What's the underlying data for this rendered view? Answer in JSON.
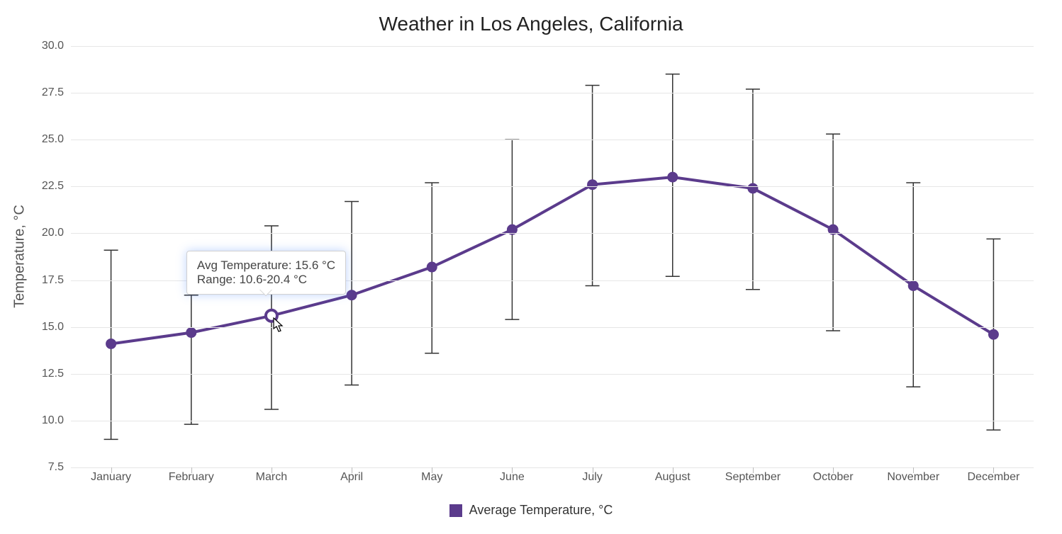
{
  "chart_data": {
    "type": "line",
    "title": "Weather in Los Angeles, California",
    "ylabel": "Temperature, °C",
    "xlabel": "",
    "categories": [
      "January",
      "February",
      "March",
      "April",
      "May",
      "June",
      "July",
      "August",
      "September",
      "October",
      "November",
      "December"
    ],
    "series": [
      {
        "name": "Average Temperature, °C",
        "values": [
          14.1,
          14.7,
          15.6,
          16.7,
          18.2,
          20.2,
          22.6,
          23.0,
          22.4,
          20.2,
          17.2,
          14.6
        ],
        "low": [
          9.0,
          9.8,
          10.6,
          11.9,
          13.6,
          15.4,
          17.2,
          17.7,
          17.0,
          14.8,
          11.8,
          9.5
        ],
        "high": [
          19.1,
          16.7,
          20.4,
          21.7,
          22.7,
          25.0,
          27.9,
          28.5,
          27.7,
          25.3,
          22.7,
          19.7
        ]
      }
    ],
    "ylim": [
      7.5,
      30.0
    ],
    "yticks": [
      7.5,
      10.0,
      12.5,
      15.0,
      17.5,
      20.0,
      22.5,
      25.0,
      27.5,
      30.0
    ],
    "grid": true,
    "legend_position": "bottom",
    "hover_index": 2,
    "tooltip": {
      "line1": "Avg Temperature: 15.6 °C",
      "line2": "Range: 10.6-20.4 °C"
    }
  },
  "legend_label": "Average Temperature, °C"
}
